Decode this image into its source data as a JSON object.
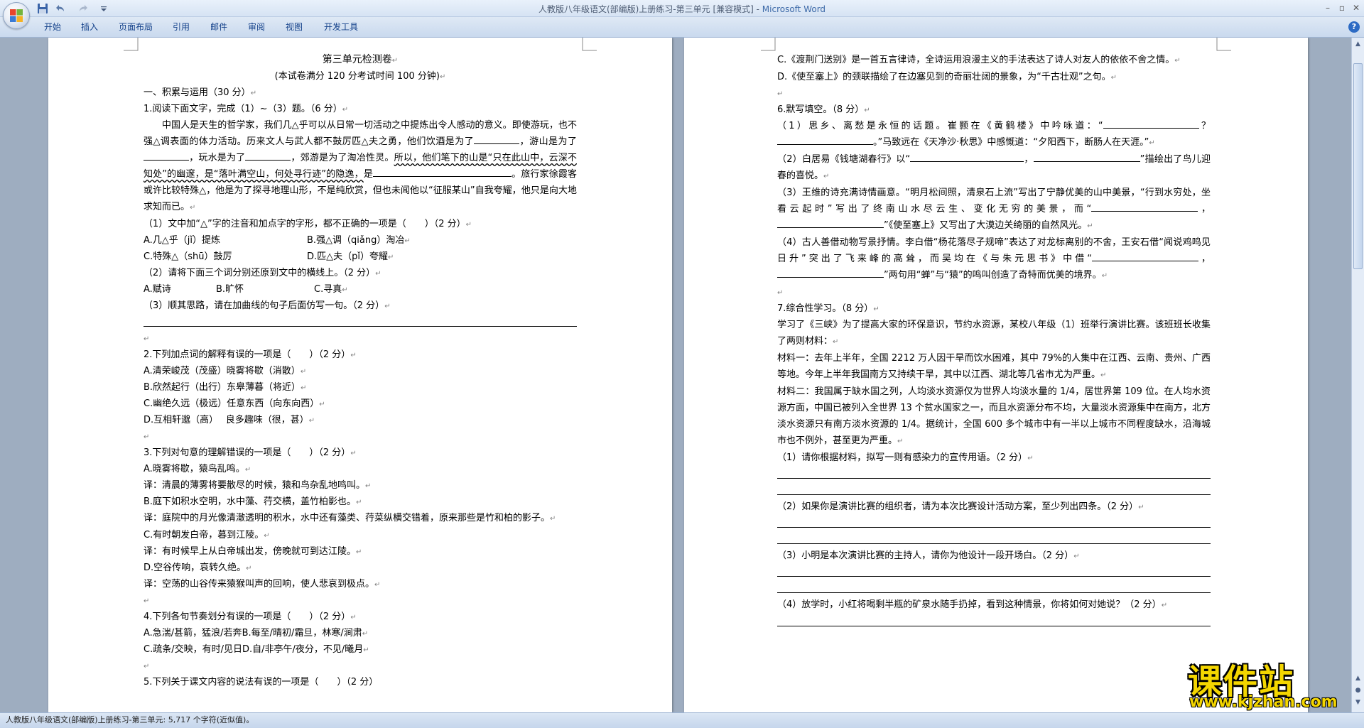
{
  "window": {
    "title_doc": "人教版八年级语文(部编版)上册练习-第三单元 [兼容模式]",
    "title_sep": " - ",
    "title_app": "Microsoft Word"
  },
  "ribbon": {
    "tabs": [
      "开始",
      "插入",
      "页面布局",
      "引用",
      "邮件",
      "审阅",
      "视图",
      "开发工具"
    ]
  },
  "left_page": {
    "title": "第三单元检测卷",
    "subtitle": "(本试卷满分 120 分考试时间 100 分钟)",
    "section1": "一、积累与运用（30 分）",
    "q1_head": "1.阅读下面文字，完成（1）~（3）题。（6 分）",
    "q1_passage_a": "中国人是天生的哲学家，我们几△乎可以从日常一切活动之中提炼出令人感动的意义。即使游玩，也不强△调表面的体力活动。历来文人与武人都不鼓厉匹△夫之勇，他们饮酒是为了",
    "q1_passage_b": "，游山是为了",
    "q1_passage_c": "，玩水是为了",
    "q1_passage_d": "，郊游是为了淘冶性灵。",
    "q1_passage_e": "所以，他们笔下的山是“只在此山中，云深不知处”的幽邃，是“落叶满空山，何处寻行迹”的隐逸，",
    "q1_passage_f": "是",
    "q1_passage_g": "。旅行家徐霞客或许比较特殊△，他是为了探寻地理山形，不是纯欣赏，但也未闻他以“征服某山”自我夸耀，他只是向大地求知而已。",
    "q1_1": "（1）文中加“△”字的注音和加点字的字形，都不正确的一项是（　　）（2 分）",
    "q1_1_a": "A.几△乎（jǐ）提炼",
    "q1_1_b": "B.强△调（qiǎng）淘冶",
    "q1_1_c": "C.特殊△（shū）鼓厉",
    "q1_1_d": "D.匹△夫（pǐ）夸耀",
    "q1_2": "（2）请将下面三个词分别还原到文中的横线上。（2 分）",
    "q1_2_a": "A.赋诗",
    "q1_2_b": "B.旷怀",
    "q1_2_c": "C.寻真",
    "q1_3": "（3）顺其思路，请在加曲线的句子后面仿写一句。（2 分）",
    "q2": "2.下列加点词的解释有误的一项是（　　）（2 分）",
    "q2_a": "A.清荣峻茂（茂盛）晓雾将歇（消散）",
    "q2_b": "B.欣然起行（出行）东皋薄暮（将近）",
    "q2_c": "C.幽绝久远（极远）任意东西（向东向西）",
    "q2_d": "D.互相轩邈（高）　 良多趣味（很，甚）",
    "q3": "3.下列对句意的理解错误的一项是（　　）（2 分）",
    "q3_a": "A.晓雾将歇，猿鸟乱鸣。",
    "q3_a_t": "译：清晨的薄雾将要散尽的时候，猿和鸟杂乱地鸣叫。",
    "q3_b": "B.庭下如积水空明，水中藻、荇交横，盖竹柏影也。",
    "q3_b_t": "译：庭院中的月光像清澈透明的积水，水中还有藻类、荇菜纵横交错着，原来那些是竹和柏的影子。",
    "q3_c": "C.有时朝发白帝，暮到江陵。",
    "q3_c_t": "译：有时候早上从白帝城出发，傍晚就可到达江陵。",
    "q3_d": "D.空谷传响，哀转久绝。",
    "q3_d_t": "译：空荡的山谷传来猿猴叫声的回响，使人悲哀到极点。",
    "q4": "4.下列各句节奏划分有误的一项是（　　）（2 分）",
    "q4_a": "A.急湍/甚箭，猛浪/若奔",
    "q4_b": "B.每至/晴初/霜旦，林寒/涧肃",
    "q4_c": "C.疏条/交映，有时/见日",
    "q4_d": "D.自/非亭午/夜分，不见/曦月",
    "q5_partial": "5.下列关于课文内容的说法有误的一项是（　　）（2 分）"
  },
  "right_page": {
    "c_line": "C.《渡荆门送别》是一首五言律诗，全诗运用浪漫主义的手法表达了诗人对友人的依依不舍之情。",
    "d_line": "D.《使至塞上》的颈联描绘了在边塞见到的奇丽壮阔的景象，为“千古壮观”之句。",
    "q6": "6.默写填空。（8 分）",
    "q6_1_a": "（1）思乡、离愁是永恒的话题。崔颢在《黄鹤楼》中吟咏道：“",
    "q6_1_b": "？",
    "q6_1_c": "。”马致远在《天净沙·秋思》中感慨道：“夕阳西下，断肠人在天涯。”",
    "q6_2_a": "（2）白居易《钱塘湖春行》以“",
    "q6_2_b": "，",
    "q6_2_c": "”描绘出了鸟儿迎春的喜悦。",
    "q6_3_a": "（3）王维的诗充满诗情画意。“明月松间照，清泉石上流”写出了宁静优美的山中美景，“行到水穷处，坐看云起时”写出了终南山水尽云生、变化无穷的美景，而“",
    "q6_3_b": "，",
    "q6_3_c": "”《使至塞上》又写出了大漠边关绮丽的自然风光。",
    "q6_4_a": "（4）古人善借动物写景抒情。李白借“杨花落尽子规啼”表达了对龙标离别的不舍，王安石借“闻说鸡鸣见日升”突出了飞来峰的高耸，而吴均在《与朱元思书》中借“",
    "q6_4_b": "，",
    "q6_4_c": "”两句用“蝉”与“猿”的鸣叫创造了奇特而优美的境界。",
    "q7": "7.综合性学习。（8 分）",
    "q7_intro": "学习了《三峡》为了提高大家的环保意识，节约水资源，某校八年级（1）班举行演讲比赛。该班班长收集了两则材料：",
    "q7_m1": "材料一：去年上半年，全国 2212 万人因干旱而饮水困难，其中 79%的人集中在江西、云南、贵州、广西等地。今年上半年我国南方又持续干旱，其中以江西、湖北等几省市尤为严重。",
    "q7_m2": "材料二：我国属于缺水国之列，人均淡水资源仅为世界人均淡水量的 1/4，居世界第 109 位。在人均水资源方面，中国已被列入全世界 13 个贫水国家之一，而且水资源分布不均，大量淡水资源集中在南方，北方淡水资源只有南方淡水资源的 1/4。据统计，全国 600 多个城市中有一半以上城市不同程度缺水，沿海城市也不例外，甚至更为严重。",
    "q7_1": "（1）请你根据材料，拟写一则有感染力的宣传用语。（2 分）",
    "q7_2": "（2）如果你是演讲比赛的组织者，请为本次比赛设计活动方案，至少列出四条。（2 分）",
    "q7_3": "（3）小明是本次演讲比赛的主持人，请你为他设计一段开场白。（2 分）",
    "q7_4": "（4）放学时，小红将喝剩半瓶的矿泉水随手扔掉，看到这种情景，你将如何对她说？（2 分）"
  },
  "status_bar": {
    "text": "人教版八年级语文(部编版)上册练习-第三单元: 5,717 个字符(近似值)。"
  },
  "watermark": {
    "cn": "课件站",
    "url": "www.kjzhan.com"
  },
  "icons": {
    "office": "office-logo-icon",
    "save": "save-icon",
    "undo": "undo-icon",
    "redo": "redo-icon",
    "customize": "qat-customize-icon",
    "help": "help-icon",
    "minimize": "minimize-icon",
    "maximize": "maximize-icon",
    "close": "close-icon"
  },
  "colors": {
    "ribbon_tab_text": "#15428b",
    "doc_background": "#9eadc0",
    "watermark_fill": "#f4d600"
  }
}
